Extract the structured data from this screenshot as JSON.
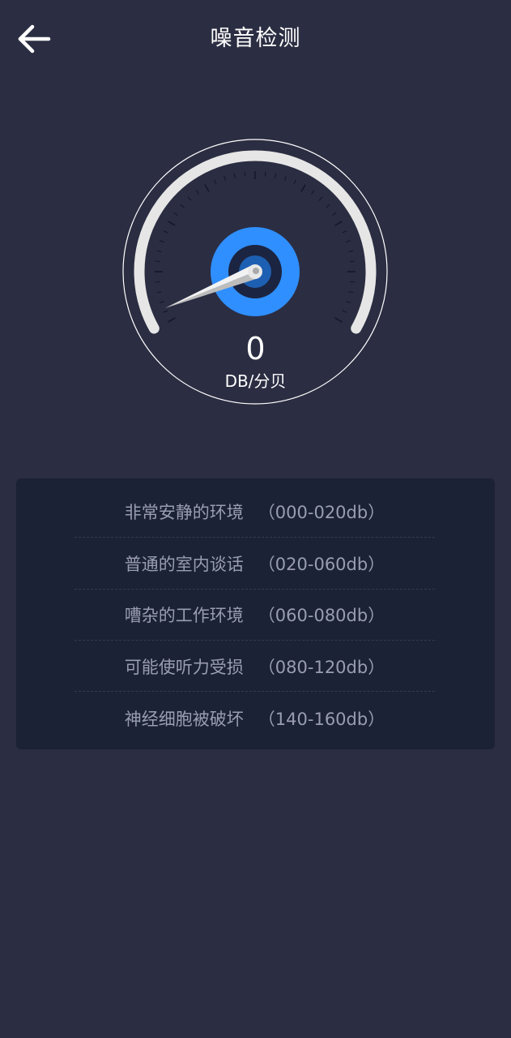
{
  "header": {
    "title": "噪音检测",
    "back_icon": "arrow-left-icon"
  },
  "gauge": {
    "value": "0",
    "unit": "DB/分贝",
    "level": 0,
    "colors": {
      "track": "#e6e6e6",
      "hub": "#2f8fff",
      "hub_inner": "#1d5fb2",
      "needle": "#e0e0e0"
    }
  },
  "levels": [
    {
      "label": "非常安静的环境",
      "range": "（000-020db）"
    },
    {
      "label": "普通的室内谈话",
      "range": "（020-060db）"
    },
    {
      "label": "嘈杂的工作环境",
      "range": "（060-080db）"
    },
    {
      "label": "可能使听力受损",
      "range": "（080-120db）"
    },
    {
      "label": "神经细胞被破坏",
      "range": "（140-160db）"
    }
  ]
}
